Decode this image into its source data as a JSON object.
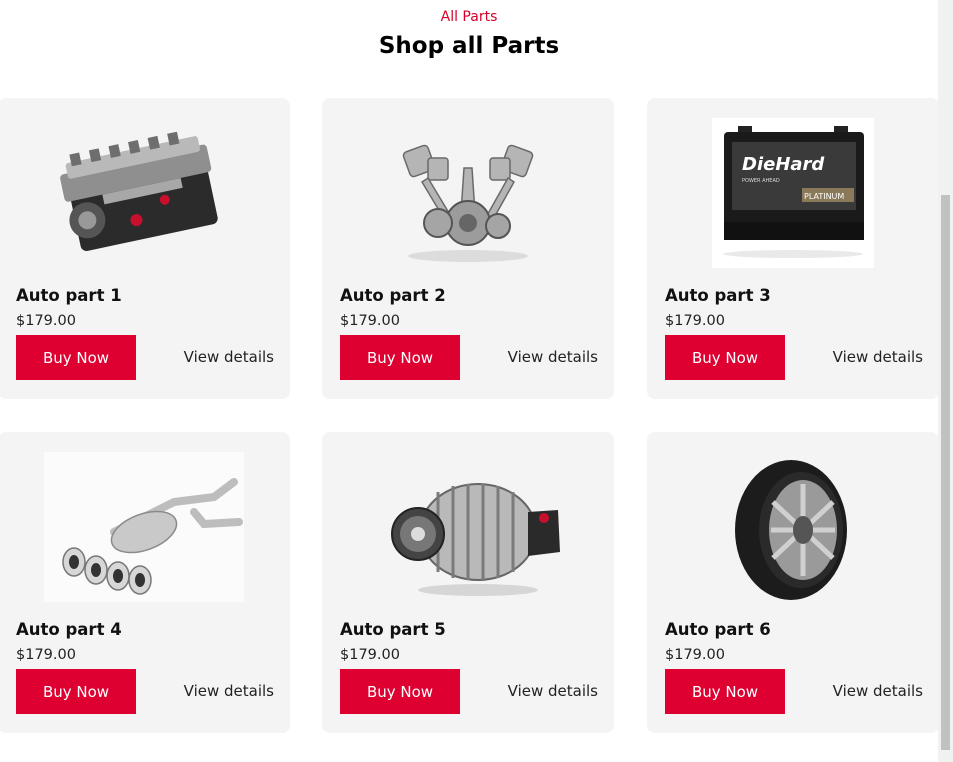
{
  "section": {
    "eyebrow": "All Parts",
    "title": "Shop all Parts"
  },
  "products": [
    {
      "name": "Auto part 1",
      "price": "$179.00",
      "buy_label": "Buy Now",
      "details_label": "View details",
      "image": "engine-image"
    },
    {
      "name": "Auto part 2",
      "price": "$179.00",
      "buy_label": "Buy Now",
      "details_label": "View details",
      "image": "pistons-crankshaft-image"
    },
    {
      "name": "Auto part 3",
      "price": "$179.00",
      "buy_label": "Buy Now",
      "details_label": "View details",
      "image": "car-battery-image"
    },
    {
      "name": "Auto part 4",
      "price": "$179.00",
      "buy_label": "Buy Now",
      "details_label": "View details",
      "image": "exhaust-system-image"
    },
    {
      "name": "Auto part 5",
      "price": "$179.00",
      "buy_label": "Buy Now",
      "details_label": "View details",
      "image": "alternator-image"
    },
    {
      "name": "Auto part 6",
      "price": "$179.00",
      "buy_label": "Buy Now",
      "details_label": "View details",
      "image": "tire-image"
    }
  ],
  "battery_logo": {
    "brand": "DieHard",
    "tagline": "POWER AHEAD",
    "grade": "PLATINUM"
  },
  "colors": {
    "accent": "#dd0030",
    "card_bg": "#f4f4f4"
  }
}
